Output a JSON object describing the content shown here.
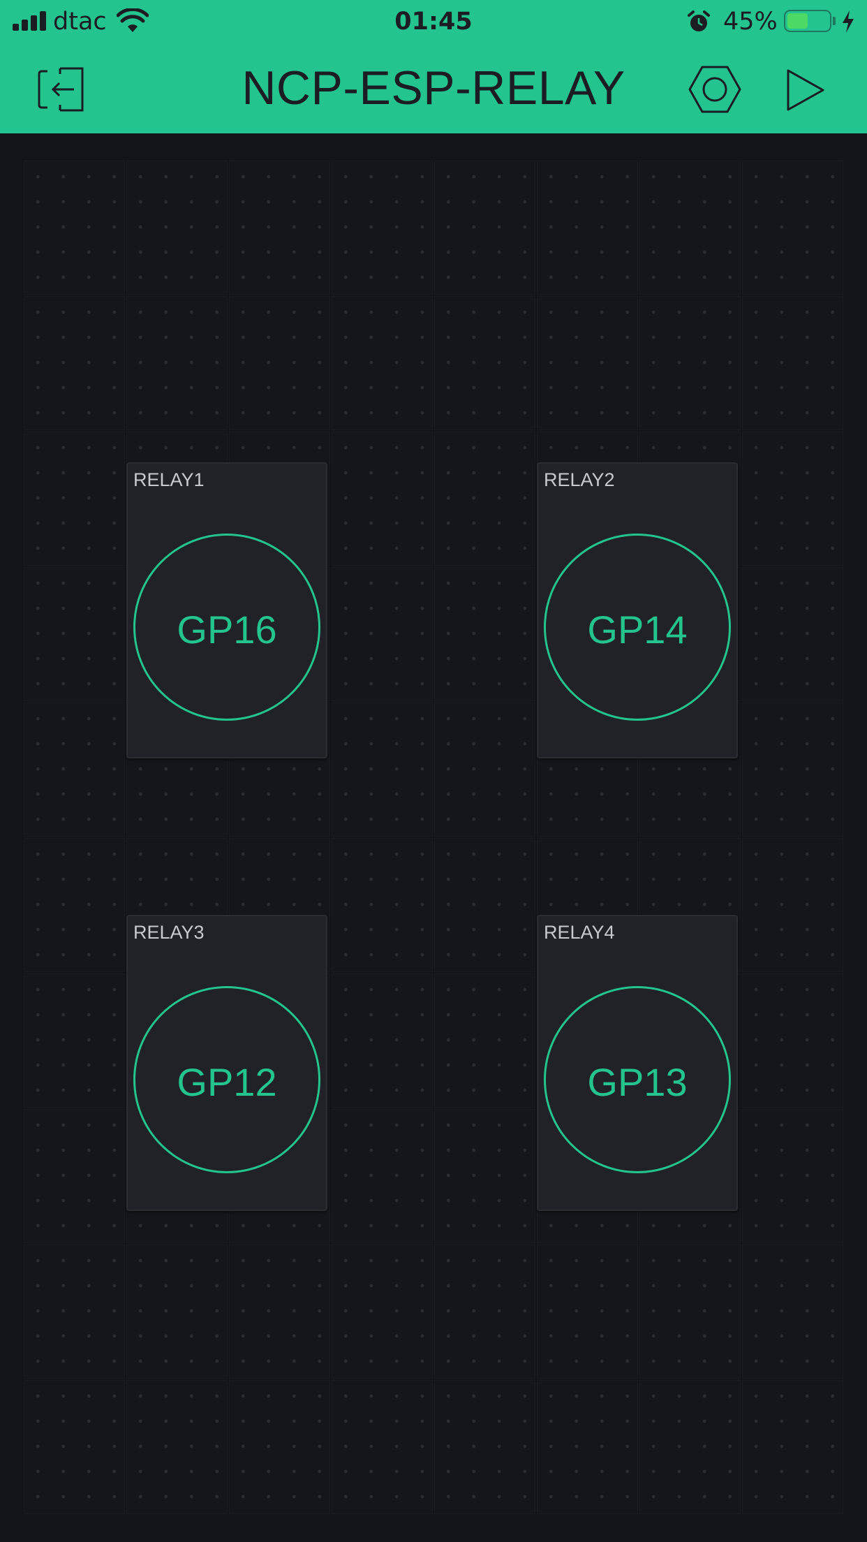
{
  "status_bar": {
    "carrier": "dtac",
    "time": "01:45",
    "battery_percent": "45%",
    "battery_level": 0.45,
    "icons": [
      "signal-icon",
      "wifi-icon",
      "alarm-icon",
      "battery-icon",
      "charging-icon"
    ]
  },
  "header": {
    "title": "NCP-ESP-RELAY",
    "icons": [
      "exit-icon",
      "settings-hexagon-icon",
      "play-icon"
    ]
  },
  "widgets": [
    {
      "label": "RELAY1",
      "button": "GP16"
    },
    {
      "label": "RELAY2",
      "button": "GP14"
    },
    {
      "label": "RELAY3",
      "button": "GP12"
    },
    {
      "label": "RELAY4",
      "button": "GP13"
    }
  ],
  "colors": {
    "accent": "#23c48e",
    "background": "#131419",
    "widget_bg": "#212227",
    "label_text": "#c7c9cf"
  }
}
